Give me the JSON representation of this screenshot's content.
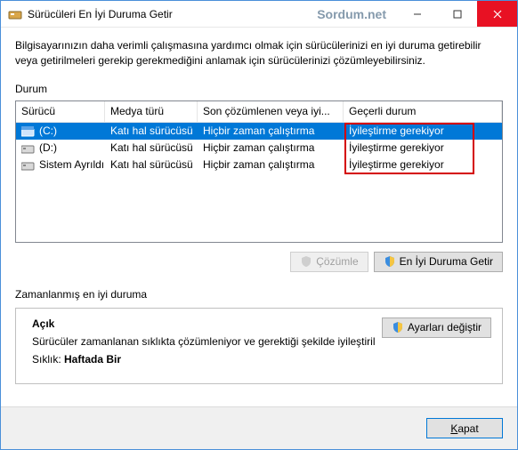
{
  "window": {
    "title": "Sürücüleri En İyi Duruma Getir",
    "watermark": "Sordum.net"
  },
  "description": "Bilgisayarınızın daha verimli çalışmasına yardımcı olmak için sürücülerinizi en iyi duruma getirebilir veya getirilmeleri gerekip gerekmediğini anlamak için sürücülerinizi çözümleyebilirsiniz.",
  "status_label": "Durum",
  "columns": {
    "c0": "Sürücü",
    "c1": "Medya türü",
    "c2": "Son çözümlenen veya iyi...",
    "c3": "Geçerli durum"
  },
  "rows": [
    {
      "drive": "(C:)",
      "media": "Katı hal sürücüsü",
      "last": "Hiçbir zaman çalıştırma",
      "state": "İyileştirme gerekiyor",
      "icon": "c",
      "selected": true
    },
    {
      "drive": "(D:)",
      "media": "Katı hal sürücüsü",
      "last": "Hiçbir zaman çalıştırma",
      "state": "İyileştirme gerekiyor",
      "icon": "d",
      "selected": false
    },
    {
      "drive": "Sistem Ayrıldı",
      "media": "Katı hal sürücüsü",
      "last": "Hiçbir zaman çalıştırma",
      "state": "İyileştirme gerekiyor",
      "icon": "d",
      "selected": false
    }
  ],
  "buttons": {
    "analyze": "Çözümle",
    "optimize": "En İyi Duruma Getir"
  },
  "schedule": {
    "label": "Zamanlanmış en iyi duruma",
    "on": "Açık",
    "desc": "Sürücüler zamanlanan sıklıkta çözümleniyor ve gerektiği şekilde iyileştiril",
    "freq_label": "Sıklık:",
    "freq_value": "Haftada Bir",
    "settings": "Ayarları değiştir"
  },
  "footer": {
    "close_prefix": "K",
    "close_rest": "apat"
  }
}
